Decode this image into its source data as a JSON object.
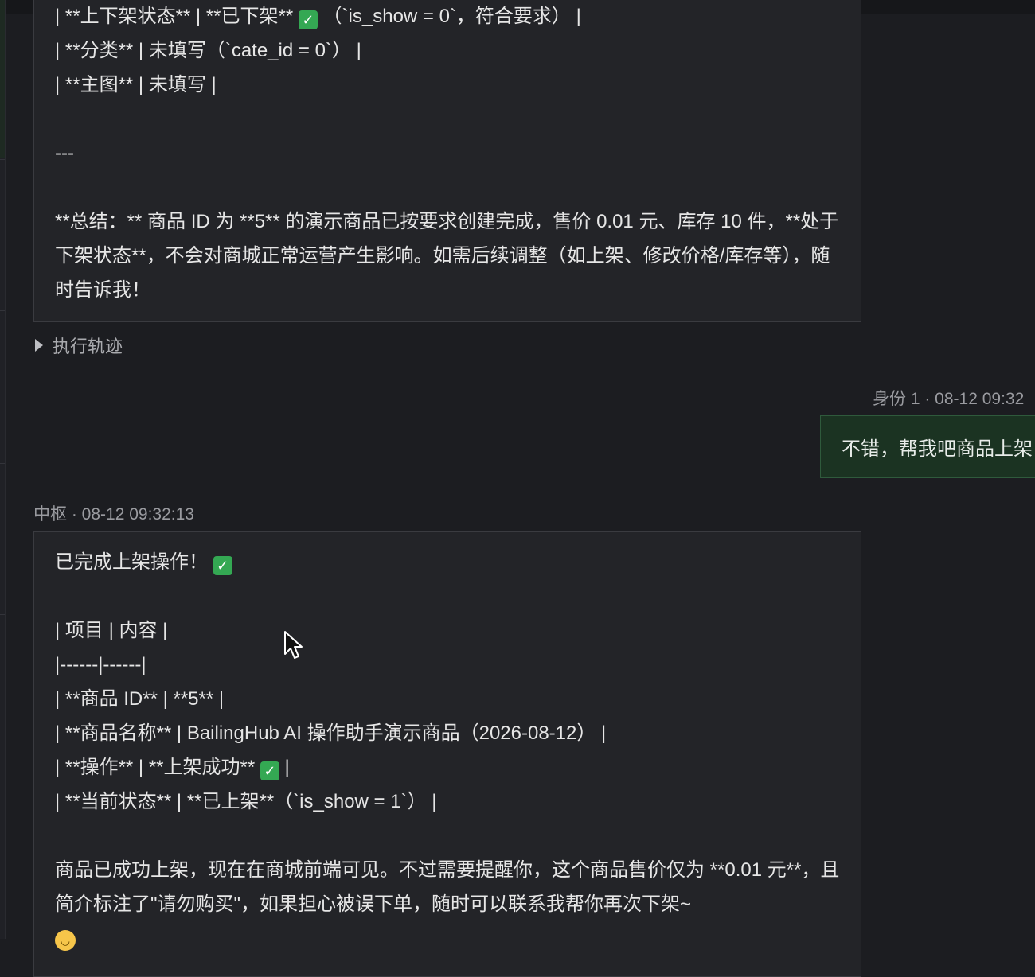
{
  "assistant_message_1": {
    "lines": [
      "| **上下架状态** | **已下架**",
      "（`is_show = 0`，符合要求） |",
      "| **分类** | 未填写（`cate_id = 0`） |",
      "| **主图** | 未填写 |",
      "---",
      "**总结：** 商品 ID 为 **5** 的演示商品已按要求创建完成，售价 0.01 元、库存 10 件，**处于下架状态**，不会对商城正常运营产生影响。如需后续调整（如上架、修改价格/库存等），随时告诉我！"
    ]
  },
  "trace_toggle": {
    "label": "执行轨迹"
  },
  "user_message": {
    "meta": "身份 1 · 08-12 09:32",
    "text": "不错，帮我吧商品上架"
  },
  "assistant_message_2": {
    "meta": "中枢 · 08-12 09:32:13",
    "lines": [
      "已完成上架操作！",
      "| 项目 | 内容 |",
      "|------|------|",
      "| **商品 ID** | **5** |",
      "| **商品名称** | BailingHub AI 操作助手演示商品（2026-08-12） |",
      "| **操作** | **上架成功**",
      " |",
      "| **当前状态** | **已上架**（`is_show = 1`） |",
      "商品已成功上架，现在在商城前端可见。不过需要提醒你，这个商品售价仅为 **0.01 元**，且简介标注了\"请勿购买\"，如果担心被误下单，随时可以联系我帮你再次下架~"
    ]
  },
  "colors": {
    "background": "#1c1d21",
    "assistant_bubble": "#232428",
    "user_bubble": "#1b3322",
    "check_green": "#34a853"
  },
  "icons": {
    "check": "white-check-mark-emoji",
    "smile": "smiling-face-emoji",
    "cursor": "mouse-pointer-icon",
    "caret": "caret-right-icon"
  }
}
